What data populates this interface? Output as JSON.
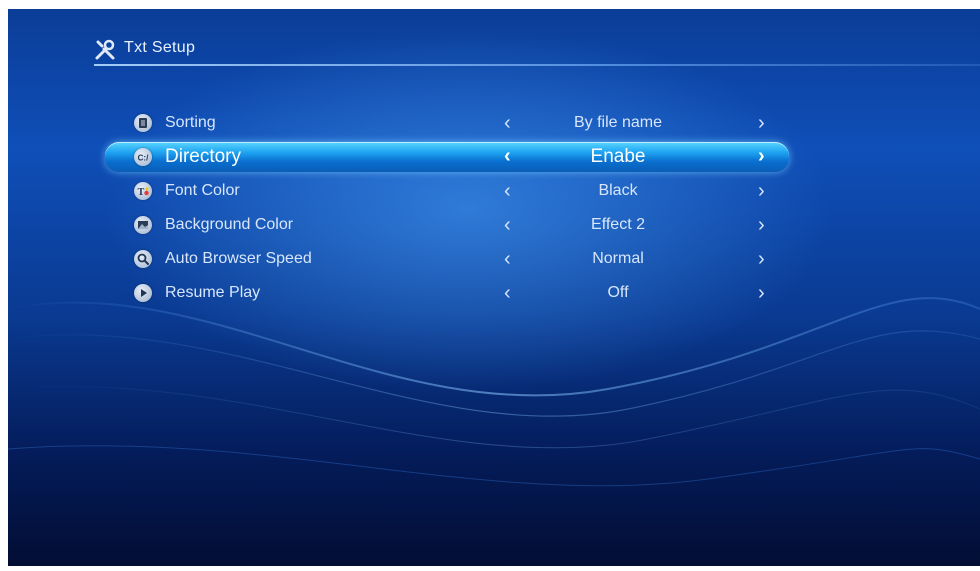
{
  "header": {
    "title": "Txt Setup",
    "icon": "tools-icon"
  },
  "settings": [
    {
      "icon": "document-icon",
      "label": "Sorting",
      "value": "By file name",
      "selected": false
    },
    {
      "icon": "directory-icon",
      "icon_text": "C:/",
      "label": "Directory",
      "value": "Enabe",
      "selected": true
    },
    {
      "icon": "font-color-icon",
      "icon_text": "T",
      "label": "Font Color",
      "value": "Black",
      "selected": false
    },
    {
      "icon": "picture-icon",
      "label": "Background Color",
      "value": "Effect 2",
      "selected": false
    },
    {
      "icon": "magnifier-icon",
      "label": "Auto Browser Speed",
      "value": "Normal",
      "selected": false
    },
    {
      "icon": "play-icon",
      "label": "Resume Play",
      "value": "Off",
      "selected": false
    }
  ],
  "arrows": {
    "left": "‹",
    "right": "›"
  },
  "colors": {
    "highlight": "#1ea3f1",
    "text": "#d7e6fb",
    "background": "#0b3d97"
  }
}
